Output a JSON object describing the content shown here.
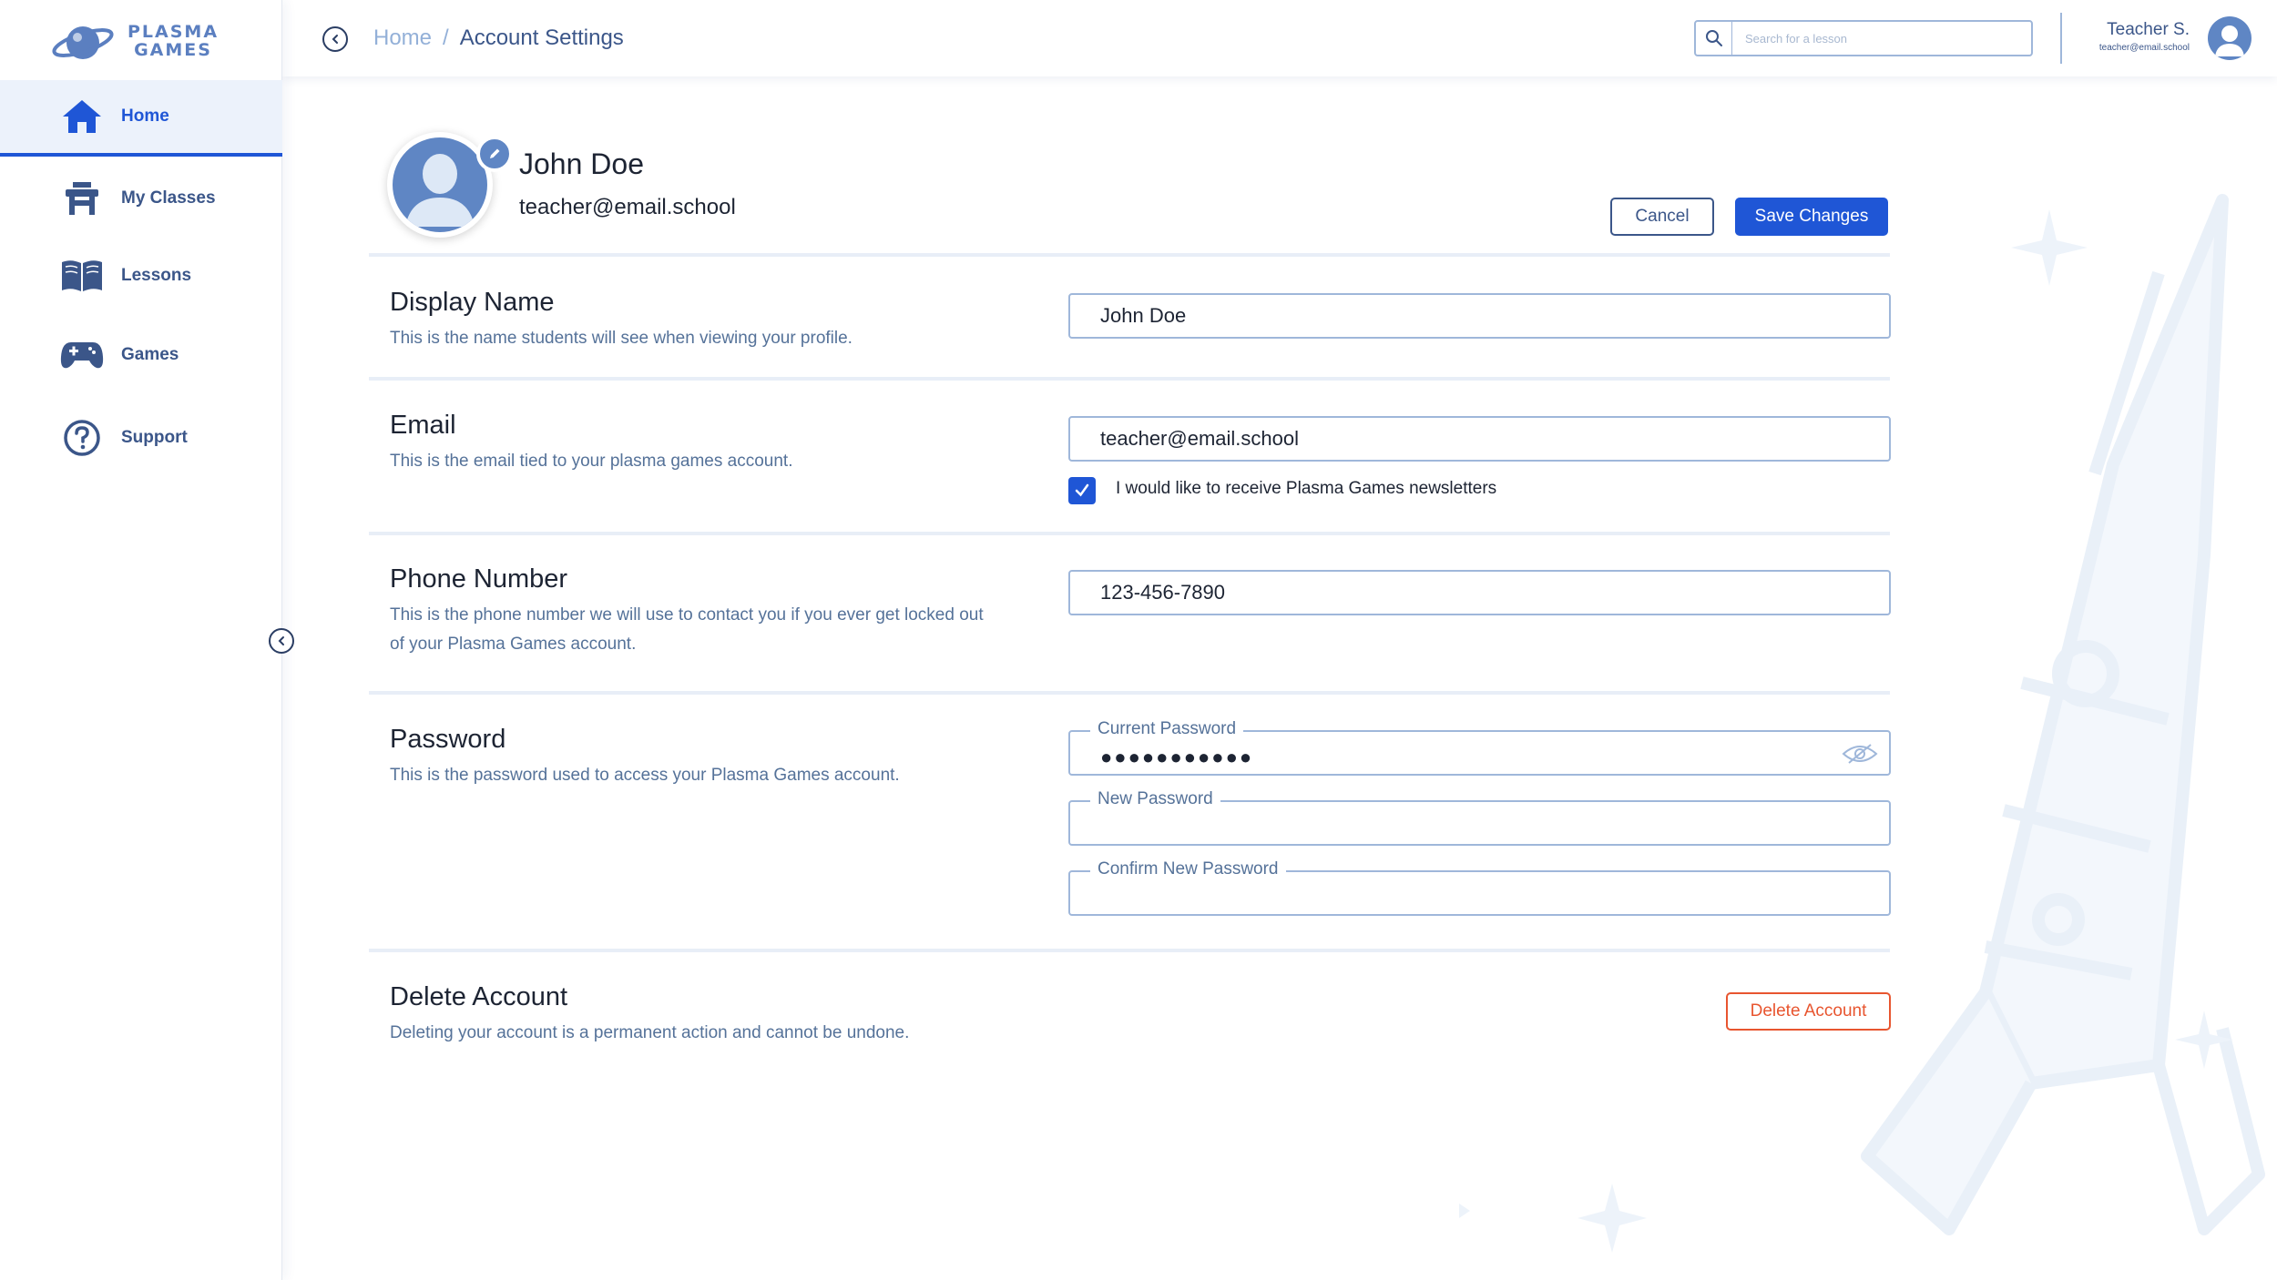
{
  "brand": {
    "name_line1": "PLASMA",
    "name_line2": "GAMES"
  },
  "sidebar": {
    "items": [
      {
        "label": "Home",
        "icon": "home-icon",
        "active": true
      },
      {
        "label": "My Classes",
        "icon": "classroom-desk-icon",
        "active": false
      },
      {
        "label": "Lessons",
        "icon": "book-icon",
        "active": false
      },
      {
        "label": "Games",
        "icon": "gamepad-icon",
        "active": false
      },
      {
        "label": "Support",
        "icon": "help-icon",
        "active": false
      }
    ]
  },
  "header": {
    "breadcrumb": {
      "home": "Home",
      "separator": "/",
      "current": "Account Settings"
    },
    "search_placeholder": "Search for a lesson",
    "user": {
      "name": "Teacher S.",
      "email": "teacher@email.school"
    }
  },
  "profile": {
    "name": "John Doe",
    "email": "teacher@email.school",
    "cancel_label": "Cancel",
    "save_label": "Save Changes"
  },
  "sections": {
    "display_name": {
      "title": "Display Name",
      "description": "This is the name students will see when viewing your profile.",
      "value": "John Doe"
    },
    "email": {
      "title": "Email",
      "description": "This is the email tied to your plasma games account.",
      "value": "teacher@email.school",
      "newsletter_label": "I would like to receive Plasma Games newsletters",
      "newsletter_checked": true
    },
    "phone": {
      "title": "Phone Number",
      "description": "This is the phone number we will use to contact you if you ever get locked out of your Plasma Games account.",
      "value": "123-456-7890"
    },
    "password": {
      "title": "Password",
      "description": "This is the password used to access your Plasma Games account.",
      "current_label": "Current Password",
      "current_value": "●●●●●●●●●●●",
      "new_label": "New Password",
      "confirm_label": "Confirm New Password"
    },
    "delete": {
      "title": "Delete Account",
      "description": "Deleting your account is a permanent action and cannot be undone.",
      "button_label": "Delete Account"
    }
  },
  "colors": {
    "primary": "#1f56d6",
    "navy": "#3b5689",
    "muted": "#557299",
    "danger": "#e8552f",
    "border": "#9fb7da"
  }
}
